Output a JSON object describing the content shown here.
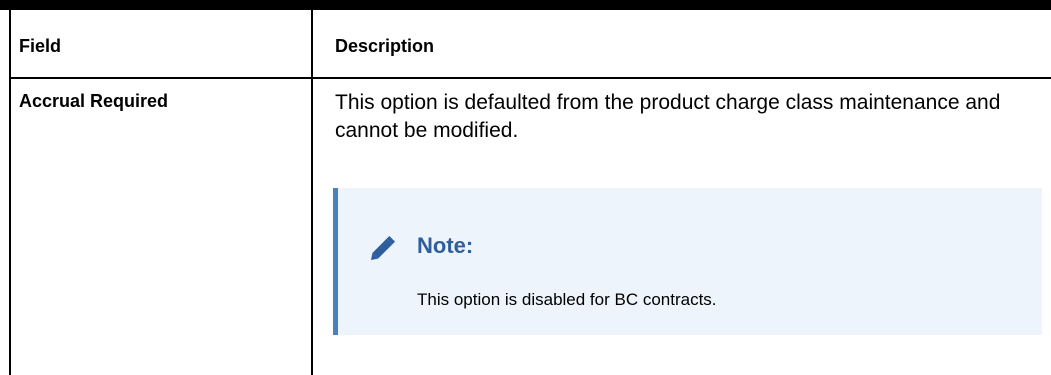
{
  "table": {
    "headers": {
      "field": "Field",
      "description": "Description"
    },
    "rows": [
      {
        "field": "Accrual Required",
        "description": "This option is defaulted from the product charge class maintenance and cannot be modified.",
        "note": {
          "icon": "pencil-icon",
          "title": "Note:",
          "text": "This option is disabled for BC contracts."
        }
      }
    ]
  },
  "colors": {
    "note_background": "#eef4fb",
    "note_accent": "#4a7fc1",
    "note_title": "#2e5e9c"
  }
}
